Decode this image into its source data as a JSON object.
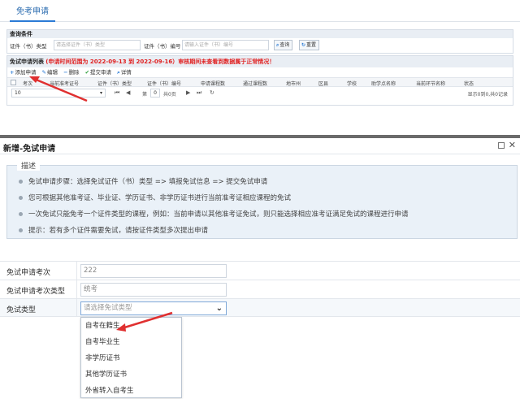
{
  "tab": {
    "label": "免考申请"
  },
  "query": {
    "title": "查询条件",
    "type_label": "证件（书）类型",
    "type_placeholder": "请选择证件（书）类型",
    "number_label": "证件（书）编号",
    "number_placeholder": "请输入证件（书）编号",
    "search_label": "查询",
    "reset_label": "重置"
  },
  "list": {
    "title": "免试申请列表",
    "notice": "(申请时间范围为 2022-09-13 到 2022-09-16）审核期间未查看到数据属于正常情况！",
    "toolbar": {
      "add": "添加申请",
      "edit": "编辑",
      "delete": "删除",
      "submit": "提交审请",
      "detail": "详情"
    },
    "columns": [
      "考次",
      "当前准考证号",
      "证件（书）类型",
      "证件（书）编号",
      "申请课程数",
      "通过课程数",
      "地市州",
      "区县",
      "学校",
      "助学点名称",
      "当前环节名称",
      "状态"
    ],
    "pager": {
      "page_size": "10",
      "page_prefix": "第",
      "page_value": "0",
      "page_suffix": "共0页",
      "info": "显示0到0,共0记录"
    }
  },
  "dialog": {
    "title": "新增-免试申请",
    "desc_title": "描述",
    "desc_items": [
      "免试申请步骤：选择免试证件（书）类型 => 填报免试信息 => 提交免试申请",
      "您可根据其他准考证、毕业证、学历证书、非学历证书进行当前准考证相应课程的免试",
      "一次免试只能免考一个证件类型的课程，例如：当前申请以其他准考证免试，则只能选择相应准考证满足免试的课程进行申请",
      "提示：若有多个证件需要免试，请按证件类型多次提出申请"
    ],
    "fields": {
      "exam_times_label": "免试申请考次",
      "exam_times_value": "222",
      "exam_type_label": "免试申请考次类型",
      "exam_type_value": "统考",
      "exempt_type_label": "免试类型",
      "exempt_type_placeholder": "请选择免试类型"
    },
    "options": [
      "自考在籍生",
      "自考毕业生",
      "非学历证书",
      "其他学历证书",
      "外省转入自考生"
    ]
  }
}
